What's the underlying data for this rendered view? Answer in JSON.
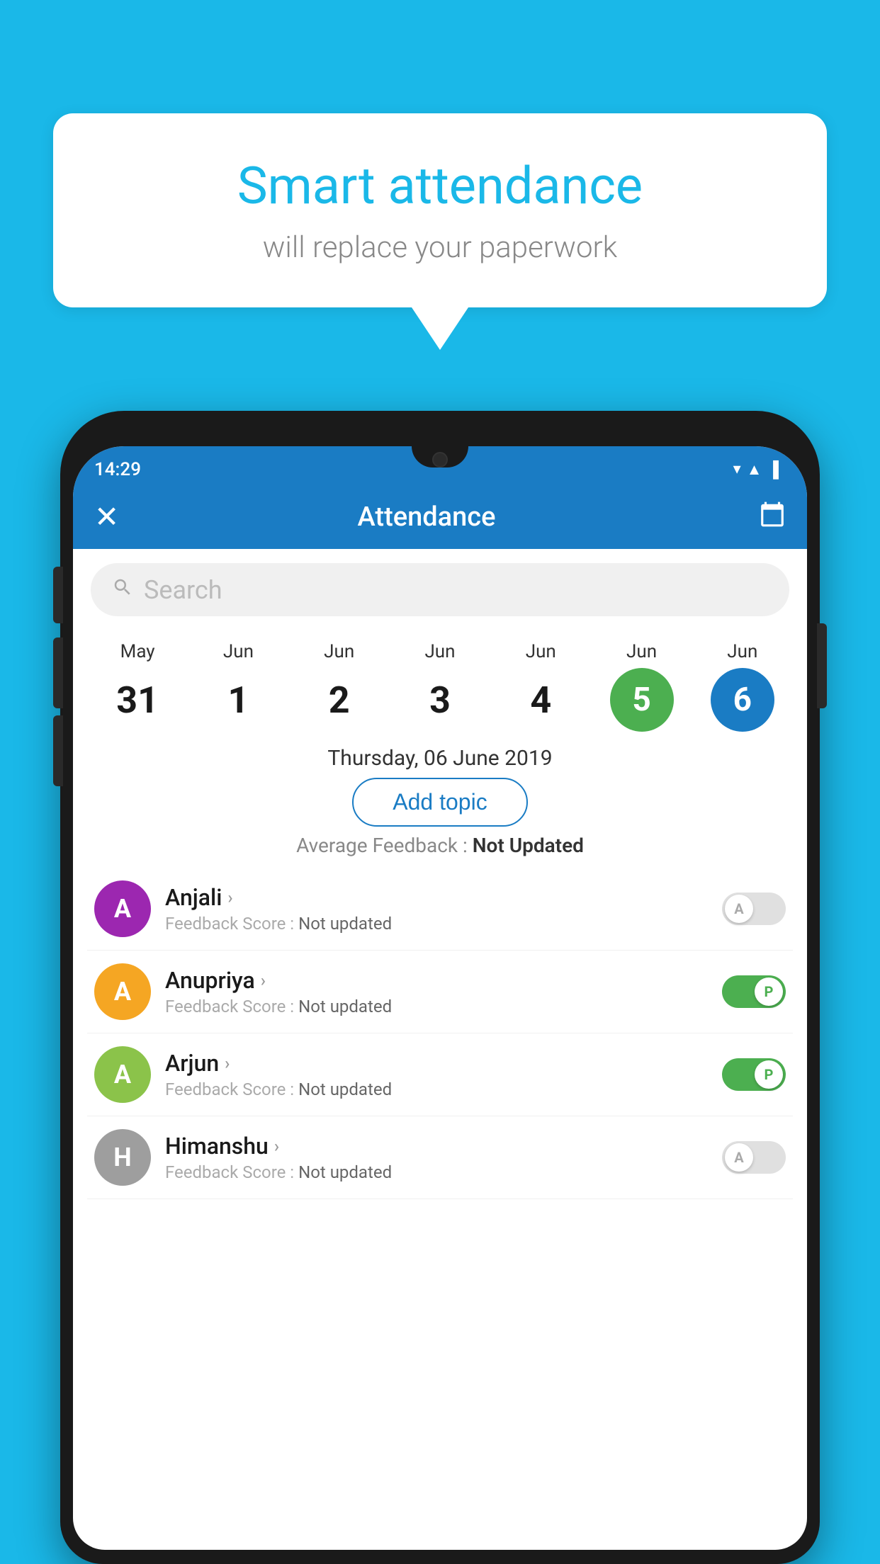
{
  "bubble": {
    "title": "Smart attendance",
    "subtitle": "will replace your paperwork"
  },
  "statusBar": {
    "time": "14:29",
    "wifi": "▼",
    "signal": "▲",
    "battery": "▐"
  },
  "appBar": {
    "close": "✕",
    "title": "Attendance",
    "calendarIcon": "📅"
  },
  "search": {
    "placeholder": "Search"
  },
  "calendar": {
    "dates": [
      {
        "month": "May",
        "day": "31",
        "style": "normal"
      },
      {
        "month": "Jun",
        "day": "1",
        "style": "normal"
      },
      {
        "month": "Jun",
        "day": "2",
        "style": "normal"
      },
      {
        "month": "Jun",
        "day": "3",
        "style": "normal"
      },
      {
        "month": "Jun",
        "day": "4",
        "style": "normal"
      },
      {
        "month": "Jun",
        "day": "5",
        "style": "today"
      },
      {
        "month": "Jun",
        "day": "6",
        "style": "selected"
      }
    ]
  },
  "selectedDate": "Thursday, 06 June 2019",
  "addTopicLabel": "Add topic",
  "averageFeedback": {
    "label": "Average Feedback : ",
    "value": "Not Updated"
  },
  "students": [
    {
      "name": "Anjali",
      "initial": "A",
      "avatarColor": "#9c27b0",
      "feedback": "Feedback Score : ",
      "feedbackValue": "Not updated",
      "attendance": "absent"
    },
    {
      "name": "Anupriya",
      "initial": "A",
      "avatarColor": "#f5a623",
      "feedback": "Feedback Score : ",
      "feedbackValue": "Not updated",
      "attendance": "present"
    },
    {
      "name": "Arjun",
      "initial": "A",
      "avatarColor": "#8bc34a",
      "feedback": "Feedback Score : ",
      "feedbackValue": "Not updated",
      "attendance": "present"
    },
    {
      "name": "Himanshu",
      "initial": "H",
      "avatarColor": "#9e9e9e",
      "feedback": "Feedback Score : ",
      "feedbackValue": "Not updated",
      "attendance": "absent"
    }
  ]
}
